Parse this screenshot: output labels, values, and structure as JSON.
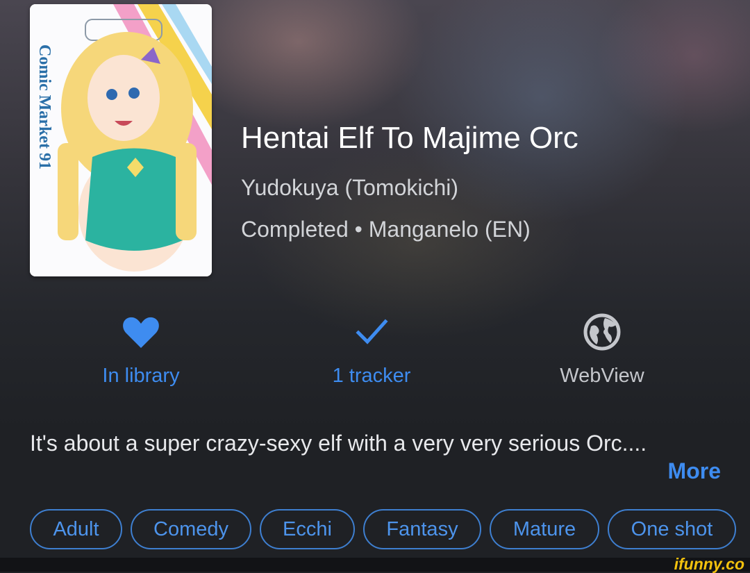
{
  "manga": {
    "title": "Hentai Elf To Majime Orc",
    "author": "Yudokuya (Tomokichi)",
    "status_line": "Completed • Manganelo (EN)",
    "cover_text": "Comic Market 91"
  },
  "actions": {
    "library": {
      "label": "In library",
      "icon": "heart-icon",
      "color": "#3e8cf0"
    },
    "tracker": {
      "label": "1 tracker",
      "icon": "check-icon",
      "color": "#3e8cf0"
    },
    "webview": {
      "label": "WebView",
      "icon": "globe-icon",
      "color": "#c4c6cb"
    }
  },
  "description": {
    "text": "It's about a super crazy-sexy elf with a very very serious Orc....",
    "more_label": "More"
  },
  "genres": [
    "Adult",
    "Comedy",
    "Ecchi",
    "Fantasy",
    "Mature",
    "One shot"
  ],
  "watermark": "ifunny.co",
  "colors": {
    "accent": "#3e8cf0",
    "background": "#1e2024"
  }
}
